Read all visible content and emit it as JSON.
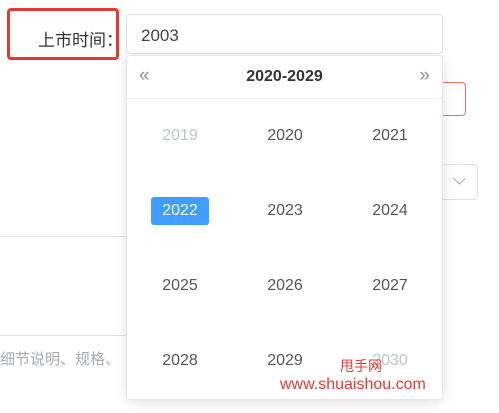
{
  "form": {
    "release_time_label": "上市时间：",
    "hint_text": "细节说明、规格、"
  },
  "picker": {
    "input_value": "2003",
    "prev_icon": "double-chevron-left-icon",
    "next_icon": "double-chevron-right-icon",
    "prev_glyph": "«",
    "next_glyph": "»",
    "decade_label": "2020-2029",
    "years": [
      {
        "label": "2019",
        "state": "disabled"
      },
      {
        "label": "2020",
        "state": "normal"
      },
      {
        "label": "2021",
        "state": "normal"
      },
      {
        "label": "2022",
        "state": "selected"
      },
      {
        "label": "2023",
        "state": "normal"
      },
      {
        "label": "2024",
        "state": "normal"
      },
      {
        "label": "2025",
        "state": "normal"
      },
      {
        "label": "2026",
        "state": "normal"
      },
      {
        "label": "2027",
        "state": "normal"
      },
      {
        "label": "2028",
        "state": "normal"
      },
      {
        "label": "2029",
        "state": "normal"
      },
      {
        "label": "2030",
        "state": "disabled"
      }
    ],
    "selected_color": "#409eff"
  },
  "watermark": {
    "brand": "甩手网",
    "url": "www.shuaishou.com"
  }
}
